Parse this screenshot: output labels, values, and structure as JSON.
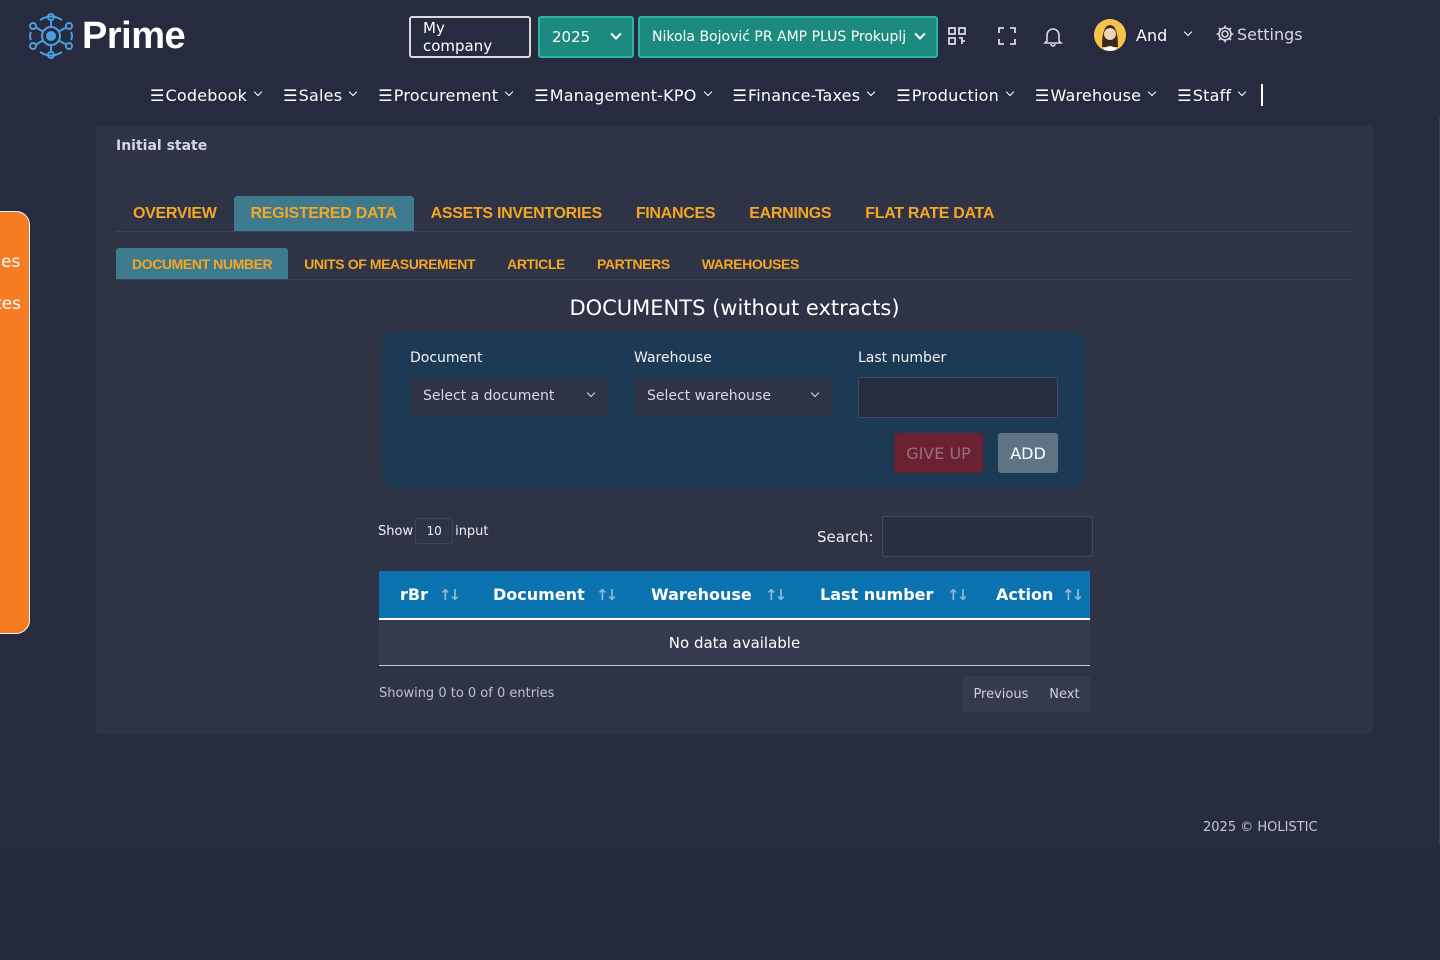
{
  "header": {
    "app_name": "Prime",
    "company_label": "My company",
    "year": "2025",
    "firm": "Nikola Bojović PR AMP PLUS Prokuplj",
    "user_name": "And",
    "settings_label": "Settings"
  },
  "menu": [
    {
      "label": "Codebook"
    },
    {
      "label": "Sales"
    },
    {
      "label": "Procurement"
    },
    {
      "label": "Management-KPO"
    },
    {
      "label": "Finance-Taxes"
    },
    {
      "label": "Production"
    },
    {
      "label": "Warehouse"
    },
    {
      "label": "Staff"
    }
  ],
  "side_panel": {
    "line1": "es",
    "line2": "tes"
  },
  "breadcrumb": "Initial state",
  "tabs": [
    {
      "label": "OVERVIEW",
      "active": false
    },
    {
      "label": "REGISTERED DATA",
      "active": true
    },
    {
      "label": "ASSETS INVENTORIES",
      "active": false
    },
    {
      "label": "FINANCES",
      "active": false
    },
    {
      "label": "EARNINGS",
      "active": false
    },
    {
      "label": "FLAT RATE DATA",
      "active": false
    }
  ],
  "subtabs": [
    {
      "label": "DOCUMENT NUMBER",
      "active": true
    },
    {
      "label": "UNITS OF MEASUREMENT",
      "active": false
    },
    {
      "label": "ARTICLE",
      "active": false
    },
    {
      "label": "PARTNERS",
      "active": false
    },
    {
      "label": "WAREHOUSES",
      "active": false
    }
  ],
  "section_title": "DOCUMENTS (without extracts)",
  "form": {
    "document_label": "Document",
    "document_placeholder": "Select a document",
    "warehouse_label": "Warehouse",
    "warehouse_placeholder": "Select warehouse",
    "last_number_label": "Last number",
    "last_number_value": "",
    "give_up_label": "GIVE UP",
    "add_label": "ADD"
  },
  "table_controls": {
    "show_label": "Show",
    "page_size": "10",
    "input_label": "input",
    "search_label": "Search:",
    "search_value": ""
  },
  "table": {
    "columns": [
      "rBr",
      "Document",
      "Warehouse",
      "Last number",
      "Action"
    ],
    "empty_message": "No data available",
    "info": "Showing 0 to 0 of 0 entries",
    "previous_label": "Previous",
    "next_label": "Next"
  },
  "footer": "2025 © HOLISTIC",
  "colors": {
    "background": "#262b3f",
    "card": "#2e3346",
    "accent_orange": "#f5a623",
    "active_tab": "#3e7a8e",
    "teal": "#1c8a7e",
    "table_header": "#0c73b1",
    "side_panel": "#f57c23"
  }
}
